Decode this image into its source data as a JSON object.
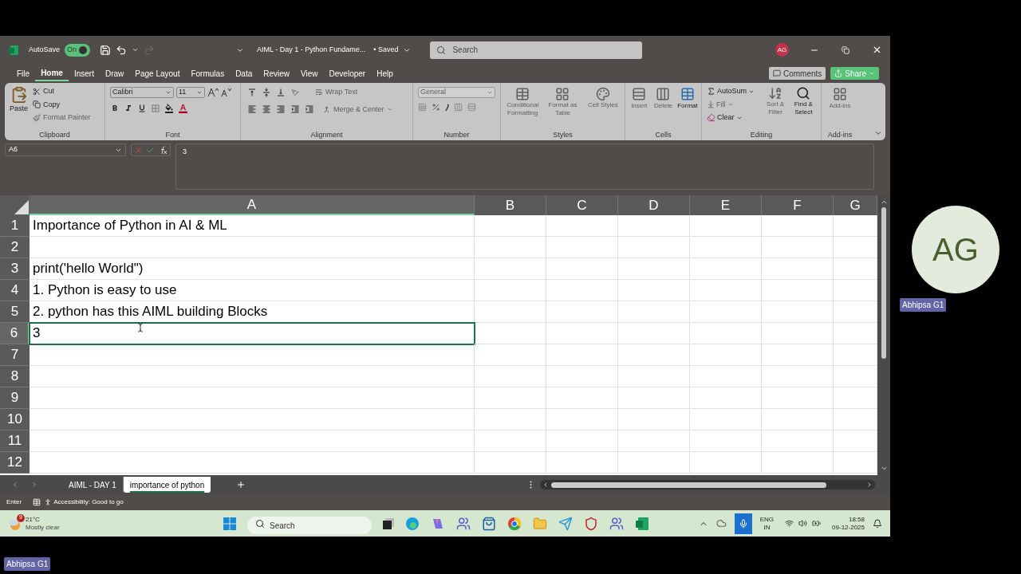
{
  "title_bar": {
    "autosave_label": "AutoSave",
    "autosave_toggle": {
      "label": "On",
      "on": true
    },
    "document_title": "AIML - Day 1 - Python Fundame...",
    "save_status": "• Saved",
    "search": {
      "placeholder": "Search"
    },
    "account_initials": "AG"
  },
  "menu_tabs": [
    {
      "label": "File",
      "selected": false
    },
    {
      "label": "Home",
      "selected": true
    },
    {
      "label": "Insert",
      "selected": false
    },
    {
      "label": "Draw",
      "selected": false
    },
    {
      "label": "Page Layout",
      "selected": false
    },
    {
      "label": "Formulas",
      "selected": false
    },
    {
      "label": "Data",
      "selected": false
    },
    {
      "label": "Review",
      "selected": false
    },
    {
      "label": "View",
      "selected": false
    },
    {
      "label": "Developer",
      "selected": false
    },
    {
      "label": "Help",
      "selected": false
    }
  ],
  "comments_button": "Comments",
  "share_button": "Share",
  "ribbon": {
    "clipboard": {
      "label": "Clipboard",
      "paste": "Paste",
      "cut": "Cut",
      "copy": "Copy",
      "format_painter": {
        "label": "Format Painter",
        "disabled": true
      }
    },
    "font": {
      "label": "Font",
      "font_name": "Calibri",
      "font_size": "11"
    },
    "alignment": {
      "label": "Alignment",
      "wrap_text": {
        "label": "Wrap Text",
        "disabled": true
      },
      "merge_center": {
        "label": "Merge & Center",
        "disabled": true
      }
    },
    "number": {
      "label": "Number",
      "format": {
        "value": "General",
        "disabled": true
      }
    },
    "styles": {
      "label": "Styles",
      "buttons": [
        {
          "label": "Conditional Formatting",
          "disabled": true
        },
        {
          "label": "Format as Table",
          "disabled": true
        },
        {
          "label": "Cell Styles",
          "disabled": true
        }
      ]
    },
    "cells": {
      "label": "Cells",
      "buttons": [
        {
          "label": "Insert",
          "disabled": true
        },
        {
          "label": "Delete",
          "disabled": true
        },
        {
          "label": "Format",
          "disabled": false
        }
      ]
    },
    "editing": {
      "label": "Editing",
      "autosum": {
        "label": "AutoSum",
        "disabled": false
      },
      "fill": {
        "label": "Fill",
        "disabled": true
      },
      "clear": {
        "label": "Clear",
        "disabled": false
      },
      "sort_filter": {
        "label": "Sort & Filter",
        "disabled": true
      },
      "find_select": {
        "label": "Find & Select",
        "disabled": false
      }
    },
    "addins": {
      "label": "Add-ins",
      "button": {
        "label": "Add-ins",
        "disabled": true
      }
    }
  },
  "formula_bar": {
    "name_box": "A6",
    "formula": "3"
  },
  "sheet": {
    "columns": [
      {
        "label": "A",
        "selected": true
      },
      {
        "label": "B",
        "selected": false
      },
      {
        "label": "C",
        "selected": false
      },
      {
        "label": "D",
        "selected": false
      },
      {
        "label": "E",
        "selected": false
      },
      {
        "label": "F",
        "selected": false
      },
      {
        "label": "G",
        "selected": false
      }
    ],
    "rows": [
      {
        "header": "1",
        "selected": false,
        "text": "Importance of Python in AI & ML"
      },
      {
        "header": "2",
        "selected": false
      },
      {
        "header": "3",
        "selected": false,
        "text": "print('hello World\")"
      },
      {
        "header": "4",
        "selected": false,
        "text": "1. Python is easy to use"
      },
      {
        "header": "5",
        "selected": false,
        "text": "2. python has this AIML building Blocks"
      },
      {
        "header": "6",
        "selected": true,
        "text": "3"
      },
      {
        "header": "7",
        "selected": false
      },
      {
        "header": "8",
        "selected": false
      },
      {
        "header": "9",
        "selected": false
      },
      {
        "header": "10",
        "selected": false
      },
      {
        "header": "11",
        "selected": false
      },
      {
        "header": "12",
        "selected": false
      }
    ]
  },
  "sheet_tabs": [
    {
      "label": "AIML - DAY 1",
      "selected": false
    },
    {
      "label": "importance of python",
      "selected": true
    }
  ],
  "status_bar": {
    "mode": "Enter",
    "accessibility": "Accessibility: Good to go"
  },
  "taskbar": {
    "weather": {
      "badge": "9",
      "temperature": "21°C",
      "condition": "Mostly clear"
    },
    "search": {
      "placeholder": "Search"
    },
    "language": "ENG",
    "region": "IN",
    "time": "18:58",
    "date": "09-12-2025"
  },
  "participant": {
    "initials": "AG",
    "name": "Abhipsa G1"
  },
  "self_view": {
    "name": "Abhipsa G1"
  }
}
